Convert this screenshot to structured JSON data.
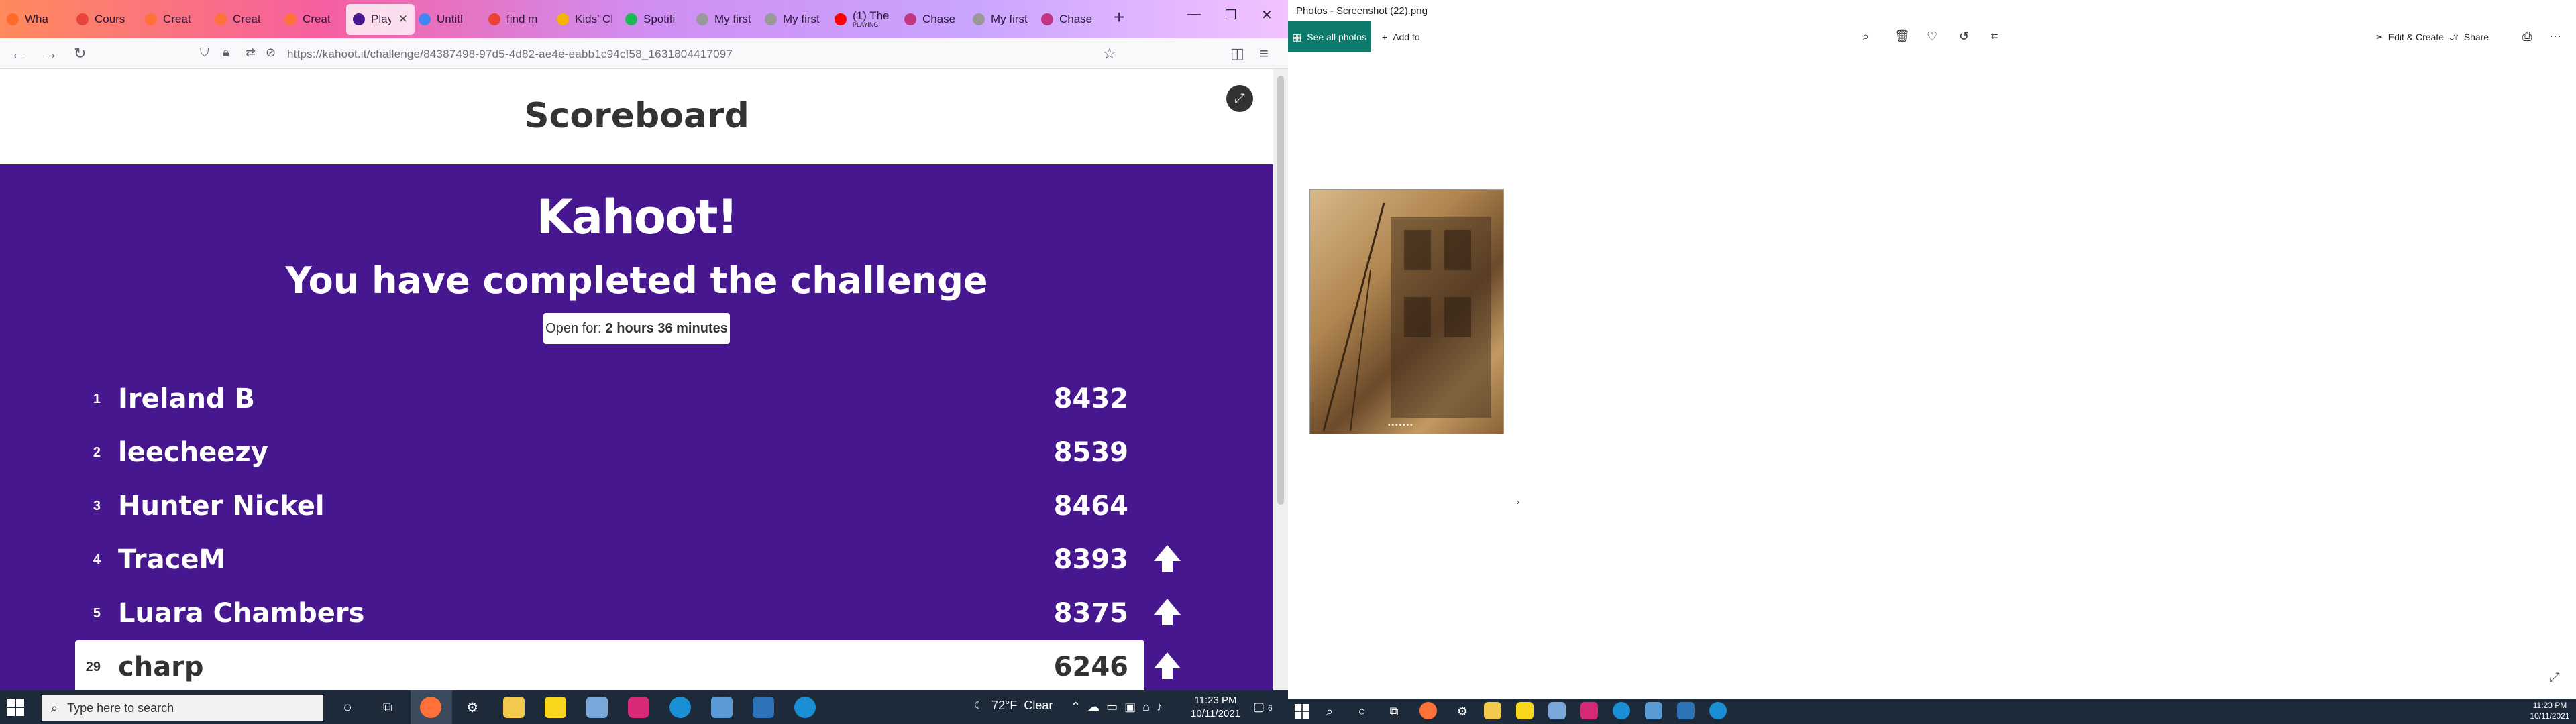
{
  "browser": {
    "tabs": [
      {
        "label": "Wha",
        "fav_color": "#ff6b2b"
      },
      {
        "label": "Cours",
        "fav_color": "#e8453c"
      },
      {
        "label": "Creat",
        "fav_color": "#ff7139"
      },
      {
        "label": "Creat",
        "fav_color": "#ff7139"
      },
      {
        "label": "Creat",
        "fav_color": "#ff7139"
      },
      {
        "label": "Play Kah",
        "fav_color": "#46178f",
        "active": true
      },
      {
        "label": "Untitl",
        "fav_color": "#4285f4"
      },
      {
        "label": "find m",
        "fav_color": "#ea4335"
      },
      {
        "label": "Kids' Class",
        "fav_color": "#f4b400"
      },
      {
        "label": "Spotifi",
        "fav_color": "#1db954"
      },
      {
        "label": "My first pa",
        "fav_color": "#999999"
      },
      {
        "label": "My first pa",
        "fav_color": "#999999"
      },
      {
        "label": "(1) The",
        "sub": "PLAYING",
        "fav_color": "#ff0000"
      },
      {
        "label": "Chase",
        "fav_color": "#c13584"
      },
      {
        "label": "My first pa",
        "fav_color": "#999999"
      },
      {
        "label": "Chase",
        "fav_color": "#c13584"
      }
    ],
    "new_tab": "+",
    "url": "https://kahoot.it/challenge/84387498-97d5-4d82-ae4e-eabb1c94cf58_1631804417097"
  },
  "kahoot": {
    "scoreboard_title": "Scoreboard",
    "logo": "Kahoot!",
    "completed_message": "You have completed the challenge",
    "open_for_label": "Open for:",
    "open_for_value": "2 hours 36 minutes",
    "rows": [
      {
        "rank": "1",
        "name": "Ireland B",
        "score": "8432",
        "arrow": false
      },
      {
        "rank": "2",
        "name": "leecheezy",
        "score": "8539",
        "arrow": false
      },
      {
        "rank": "3",
        "name": "Hunter Nickel",
        "score": "8464",
        "arrow": false
      },
      {
        "rank": "4",
        "name": "TraceM",
        "score": "8393",
        "arrow": true
      },
      {
        "rank": "5",
        "name": "Luara Chambers",
        "score": "8375",
        "arrow": true
      },
      {
        "rank": "29",
        "name": "charp",
        "score": "6246",
        "arrow": true,
        "me": true
      }
    ]
  },
  "taskbar_left": {
    "search_placeholder": "Type here to search",
    "weather_temp": "72°F",
    "weather_cond": "Clear",
    "time": "11:23 PM",
    "date": "10/11/2021",
    "notifications": "6"
  },
  "photos": {
    "window_title": "Photos - Screenshot (22).png",
    "see_all": "See all photos",
    "add_to": "Add to",
    "edit_create": "Edit & Create",
    "share": "Share",
    "time": "11:23 PM",
    "date": "10/11/2021"
  }
}
